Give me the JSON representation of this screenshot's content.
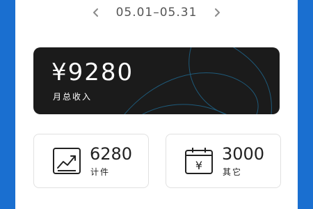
{
  "date_nav": {
    "range": "05.01–05.31",
    "prev_icon": "chevron-left-icon",
    "next_icon": "chevron-right-icon"
  },
  "income": {
    "amount": "¥9280",
    "label": "月总收入"
  },
  "stats": [
    {
      "value": "6280",
      "label": "计件",
      "icon": "trend-chart-icon"
    },
    {
      "value": "3000",
      "label": "其它",
      "icon": "calendar-yen-icon"
    }
  ],
  "colors": {
    "background": "#1a6fd0",
    "card": "#ffffff",
    "income_card": "#1b1b1b",
    "deco_lines": "#1e5a7a"
  }
}
